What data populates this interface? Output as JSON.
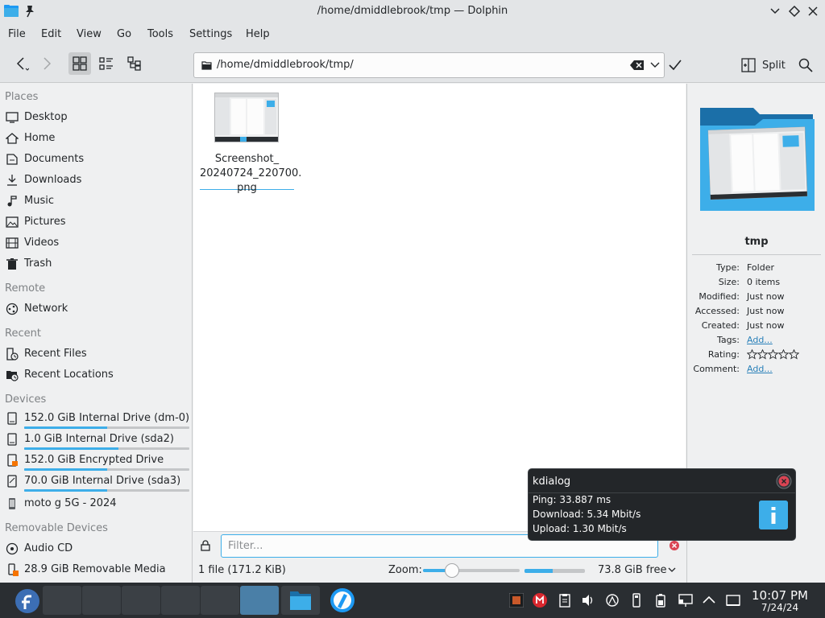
{
  "window": {
    "title": "/home/dmiddlebrook/tmp — Dolphin"
  },
  "menu": [
    "File",
    "Edit",
    "View",
    "Go",
    "Tools",
    "Settings",
    "Help"
  ],
  "toolbar": {
    "path": "/home/dmiddlebrook/tmp/",
    "split_label": "Split"
  },
  "sidebar": {
    "places_header": "Places",
    "places": [
      {
        "label": "Desktop",
        "icon": "desktop-icon"
      },
      {
        "label": "Home",
        "icon": "home-icon"
      },
      {
        "label": "Documents",
        "icon": "documents-icon"
      },
      {
        "label": "Downloads",
        "icon": "downloads-icon"
      },
      {
        "label": "Music",
        "icon": "music-icon"
      },
      {
        "label": "Pictures",
        "icon": "pictures-icon"
      },
      {
        "label": "Videos",
        "icon": "videos-icon"
      },
      {
        "label": "Trash",
        "icon": "trash-icon"
      }
    ],
    "remote_header": "Remote",
    "remote": [
      {
        "label": "Network",
        "icon": "network-icon"
      }
    ],
    "recent_header": "Recent",
    "recent": [
      {
        "label": "Recent Files",
        "icon": "recent-files-icon"
      },
      {
        "label": "Recent Locations",
        "icon": "recent-locations-icon"
      }
    ],
    "devices_header": "Devices",
    "devices": [
      {
        "label": "152.0 GiB Internal Drive (dm-0)",
        "used_fraction": 0.5
      },
      {
        "label": "1.0 GiB Internal Drive (sda2)",
        "used_fraction": 0.57
      },
      {
        "label": "152.0 GiB Encrypted Drive",
        "used_fraction": 0.5
      },
      {
        "label": "70.0 GiB Internal Drive (sda3)",
        "used_fraction": 0.5
      },
      {
        "label": "moto g 5G - 2024"
      }
    ],
    "removable_header": "Removable Devices",
    "removable": [
      {
        "label": "Audio CD",
        "icon": "audio-cd-icon"
      },
      {
        "label": "28.9 GiB Removable Media",
        "icon": "removable-media-icon"
      }
    ]
  },
  "files": [
    {
      "name_lines": [
        "Screenshot_",
        "20240724_220700.",
        "png"
      ]
    }
  ],
  "filter": {
    "placeholder": "Filter..."
  },
  "status": {
    "count": "1 file (171.2 KiB)",
    "zoom_label": "Zoom:",
    "zoom_fraction": 0.3,
    "used_space_fraction": 0.47,
    "free_space": "73.8 GiB free"
  },
  "info": {
    "name": "tmp",
    "rows": [
      {
        "key": "Type:",
        "value": "Folder",
        "link": false
      },
      {
        "key": "Size:",
        "value": "0 items",
        "link": false
      },
      {
        "key": "Modified:",
        "value": "Just now",
        "link": false
      },
      {
        "key": "Accessed:",
        "value": "Just now",
        "link": false
      },
      {
        "key": "Created:",
        "value": "Just now",
        "link": false
      },
      {
        "key": "Tags:",
        "value": "Add...",
        "link": true
      },
      {
        "key": "Rating:",
        "value": "",
        "stars": 5
      },
      {
        "key": "Comment:",
        "value": "Add...",
        "link": true
      }
    ]
  },
  "notification": {
    "title": "kdialog",
    "lines": [
      "Ping: 33.887 ms",
      "Download: 5.34 Mbit/s",
      "Upload: 1.30 Mbit/s"
    ]
  },
  "clock": {
    "time": "10:07 PM",
    "date": "7/24/24"
  },
  "colors": {
    "accent": "#3daee9",
    "taskbar": "#2a2e32",
    "folder": "#1e88c7"
  }
}
